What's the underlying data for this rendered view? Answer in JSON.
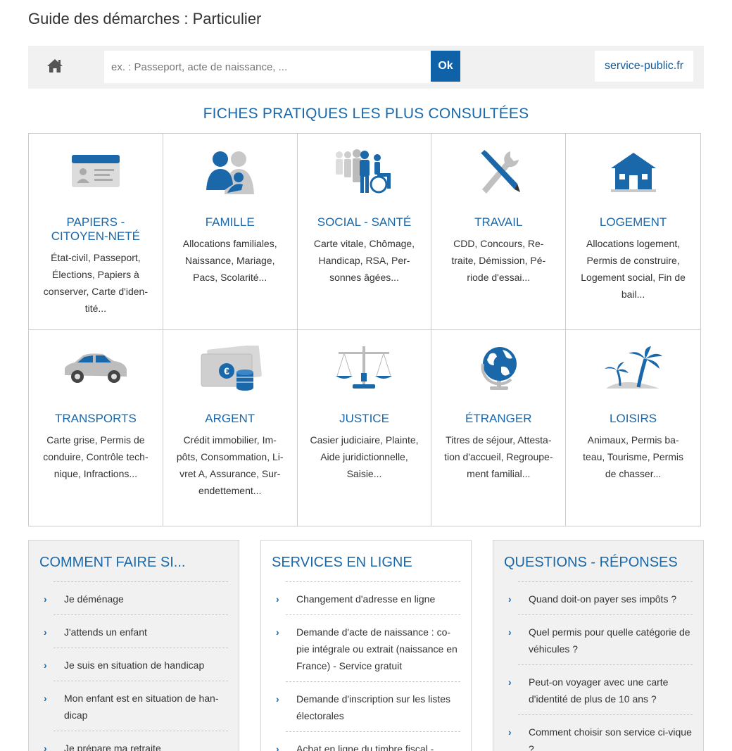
{
  "page": {
    "title": "Guide des démarches : Particulier"
  },
  "search": {
    "placeholder": "ex. : Passeport, acte de naissance, ...",
    "submit_label": "Ok",
    "site_link": "service-public.fr"
  },
  "section": {
    "title": "FICHES PRATIQUES LES PLUS CONSULTÉES"
  },
  "colors": {
    "accent": "#1a68aa",
    "button": "#0f62a8",
    "icon_grey": "#b7b7b7"
  },
  "cards": [
    {
      "icon": "id-card-icon",
      "title": "PAPIERS - CITOYEN-NETÉ",
      "desc": "État-civil, Passeport, Élections, Papiers à conserver, Carte d'iden-tité..."
    },
    {
      "icon": "family-icon",
      "title": "FAMILLE",
      "desc": "Allocations familiales, Naissance, Mariage, Pacs, Scolarité..."
    },
    {
      "icon": "social-health-icon",
      "title": "SOCIAL - SANTÉ",
      "desc": "Carte vitale, Chômage, Handicap, RSA, Per-sonnes âgées..."
    },
    {
      "icon": "tools-icon",
      "title": "TRAVAIL",
      "desc": "CDD, Concours, Re-traite, Démission, Pé-riode d'essai..."
    },
    {
      "icon": "house-icon",
      "title": "LOGEMENT",
      "desc": "Allocations logement, Permis de construire, Logement social, Fin de bail..."
    },
    {
      "icon": "car-icon",
      "title": "TRANSPORTS",
      "desc": "Carte grise, Permis de conduire, Contrôle tech-nique, Infractions..."
    },
    {
      "icon": "money-icon",
      "title": "ARGENT",
      "desc": "Crédit immobilier, Im-pôts, Consommation, Li-vret A, Assurance, Sur-endettement..."
    },
    {
      "icon": "scales-icon",
      "title": "JUSTICE",
      "desc": "Casier judiciaire, Plainte, Aide juridictionnelle, Saisie..."
    },
    {
      "icon": "globe-icon",
      "title": "ÉTRANGER",
      "desc": "Titres de séjour, Attesta-tion d'accueil, Regroupe-ment familial..."
    },
    {
      "icon": "palm-tree-icon",
      "title": "LOISIRS",
      "desc": "Animaux, Permis ba-teau, Tourisme, Permis de chasser..."
    }
  ],
  "panels": {
    "how_to": {
      "title": "COMMENT FAIRE SI...",
      "items": [
        "Je déménage",
        "J'attends un enfant",
        "Je suis en situation de handicap",
        "Mon enfant est en situation de han-dicap",
        "Je prépare ma retraite"
      ]
    },
    "online": {
      "title": "SERVICES EN LIGNE",
      "items": [
        "Changement d'adresse en ligne",
        "Demande d'acte de naissance : co-pie intégrale ou extrait (naissance en France) - Service gratuit",
        "Demande d'inscription sur les listes électorales",
        "Achat en ligne du timbre fiscal -"
      ]
    },
    "faq": {
      "title": "QUESTIONS - RÉPONSES",
      "items": [
        "Quand doit-on payer ses impôts ?",
        "Quel permis pour quelle catégorie de véhicules ?",
        "Peut-on voyager avec une carte d'identité de plus de 10 ans ?",
        "Comment choisir son service ci-vique ?"
      ]
    }
  }
}
